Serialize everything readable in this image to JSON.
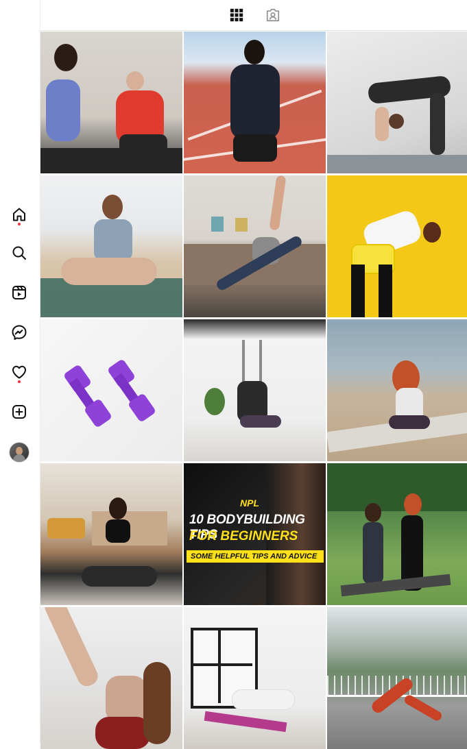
{
  "sidebar": {
    "items": [
      {
        "name": "home-icon",
        "has_dot": true
      },
      {
        "name": "search-icon",
        "has_dot": false
      },
      {
        "name": "reels-icon",
        "has_dot": false
      },
      {
        "name": "messenger-icon",
        "has_dot": false
      },
      {
        "name": "heart-icon",
        "has_dot": true
      },
      {
        "name": "create-icon",
        "has_dot": false
      },
      {
        "name": "profile-avatar",
        "has_dot": false
      }
    ],
    "notification_dot_color": "#ff3040"
  },
  "tabs": [
    {
      "name": "grid-icon",
      "active": true
    },
    {
      "name": "tagged-icon",
      "active": false
    }
  ],
  "posts": [
    {
      "subject": "trainer-and-senior-stretching"
    },
    {
      "subject": "sprinter-on-track"
    },
    {
      "subject": "backbend-yoga"
    },
    {
      "subject": "beach-meditation"
    },
    {
      "subject": "triangle-pose-living-room"
    },
    {
      "subject": "side-stretch-yellow-background"
    },
    {
      "subject": "purple-dumbbells"
    },
    {
      "subject": "aerial-yoga"
    },
    {
      "subject": "lakeside-yoga"
    },
    {
      "subject": "home-meditation"
    },
    {
      "subject": "bodybuilding-tips-graphic",
      "overlay": {
        "logo": "NPL",
        "line1": "10 BODYBUILDING TIPS",
        "line2": "FOR BEGINNERS",
        "line3": "SOME HELPFUL TIPS AND ADVICE"
      }
    },
    {
      "subject": "outdoor-yoga-pair"
    },
    {
      "subject": "standing-split-stretch"
    },
    {
      "subject": "wheel-pose-loft"
    },
    {
      "subject": "mountain-downward-dog"
    }
  ]
}
